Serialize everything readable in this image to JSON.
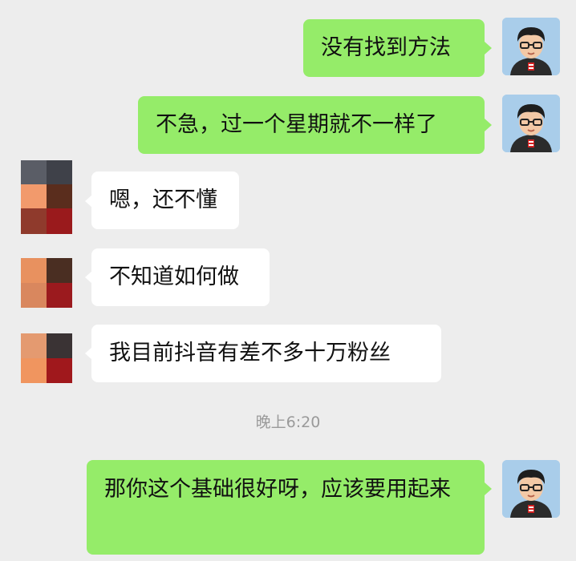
{
  "messages": [
    {
      "side": "me",
      "text": "没有找到方法"
    },
    {
      "side": "me",
      "text": "不急，过一个星期就不一样了"
    },
    {
      "side": "other",
      "text": "嗯，还不懂"
    },
    {
      "side": "other",
      "text": "不知道如何做"
    },
    {
      "side": "other",
      "text": "我目前抖音有差不多十万粉丝"
    },
    {
      "side": "me",
      "text": "那你这个基础很好呀，应该要用起来"
    }
  ],
  "timestamp": "晚上6:20",
  "colors": {
    "background": "#ededed",
    "my_bubble": "#95ec69",
    "other_bubble": "#ffffff",
    "timestamp_text": "#9a9a9a"
  },
  "icons": {
    "my_avatar": "cartoon-boy-glasses-avatar-icon",
    "other_avatar": "pixelated-avatar-icon"
  }
}
